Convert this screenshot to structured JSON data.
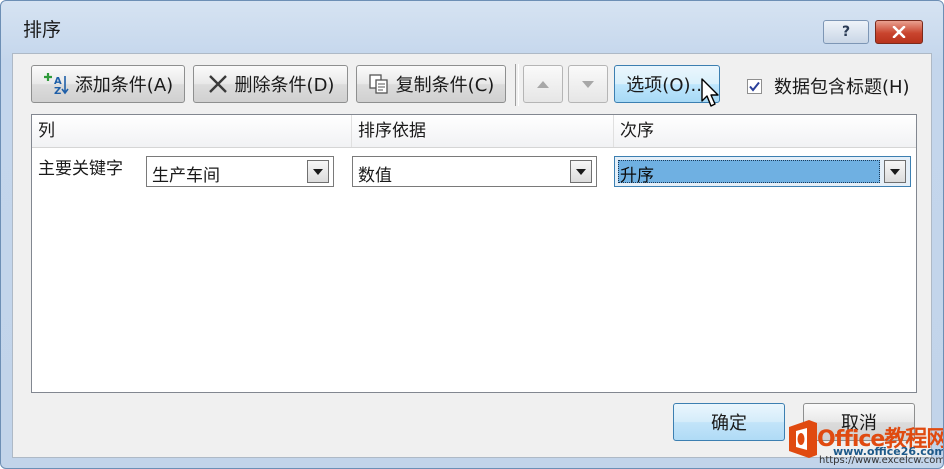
{
  "window": {
    "title": "排序",
    "help_label": "?",
    "close_icon": "close-x-icon"
  },
  "toolbar": {
    "add_label": "添加条件(A)",
    "delete_label": "删除条件(D)",
    "copy_label": "复制条件(C)",
    "move_up_icon": "triangle-up-icon",
    "move_down_icon": "triangle-down-icon",
    "options_label": "选项(O)...",
    "has_header_label": "数据包含标题(H)",
    "has_header_checked": true
  },
  "grid": {
    "headers": {
      "column": "列",
      "sort_on": "排序依据",
      "order": "次序"
    },
    "rows": [
      {
        "label": "主要关键字",
        "column_value": "生产车间",
        "sort_on_value": "数值",
        "order_value": "升序"
      }
    ]
  },
  "footer": {
    "ok_label": "确定",
    "cancel_label": "取消"
  },
  "watermark": {
    "main": "Office教程网",
    "url1": "www.office26.com",
    "url2": "https://www.excelcw.com"
  },
  "colors": {
    "accent": "#3c7fb1",
    "selection": "#6fb0e2",
    "close_red": "#c9452e",
    "watermark_orange": "#e04a10"
  }
}
